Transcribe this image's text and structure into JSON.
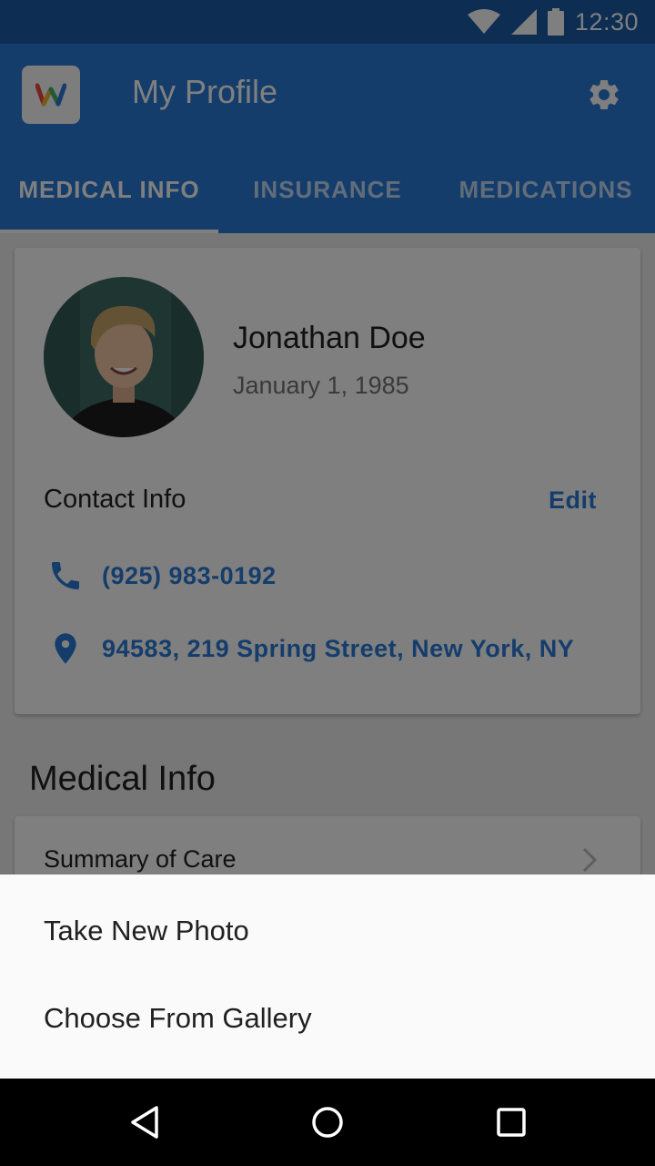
{
  "status_bar": {
    "time": "12:30"
  },
  "app_bar": {
    "title": "My Profile",
    "logo_letter": "w"
  },
  "tabs": [
    {
      "label": "MEDICAL INFO",
      "active": true
    },
    {
      "label": "INSURANCE",
      "active": false
    },
    {
      "label": "MEDICATIONS",
      "active": false
    }
  ],
  "profile": {
    "name": "Jonathan Doe",
    "dob": "January 1, 1985",
    "contact_title": "Contact Info",
    "edit_label": "Edit",
    "phone": "(925) 983-0192",
    "address": "94583, 219 Spring Street, New York, NY"
  },
  "medical": {
    "section_title": "Medical Info",
    "items": [
      {
        "label": "Summary of Care"
      }
    ]
  },
  "bottom_sheet": {
    "options": [
      "Take New Photo",
      "Choose From Gallery"
    ]
  },
  "colors": {
    "primary": "#2b7ad8",
    "status_bar": "#1a5ba6",
    "scrim": "rgba(0,0,0,0.5)"
  },
  "icons": {
    "status": [
      "wifi-icon",
      "cell-signal-icon",
      "battery-icon"
    ],
    "contact": [
      "phone-icon",
      "location-pin-icon"
    ],
    "nav": [
      "back-icon",
      "home-icon",
      "recents-icon"
    ]
  }
}
